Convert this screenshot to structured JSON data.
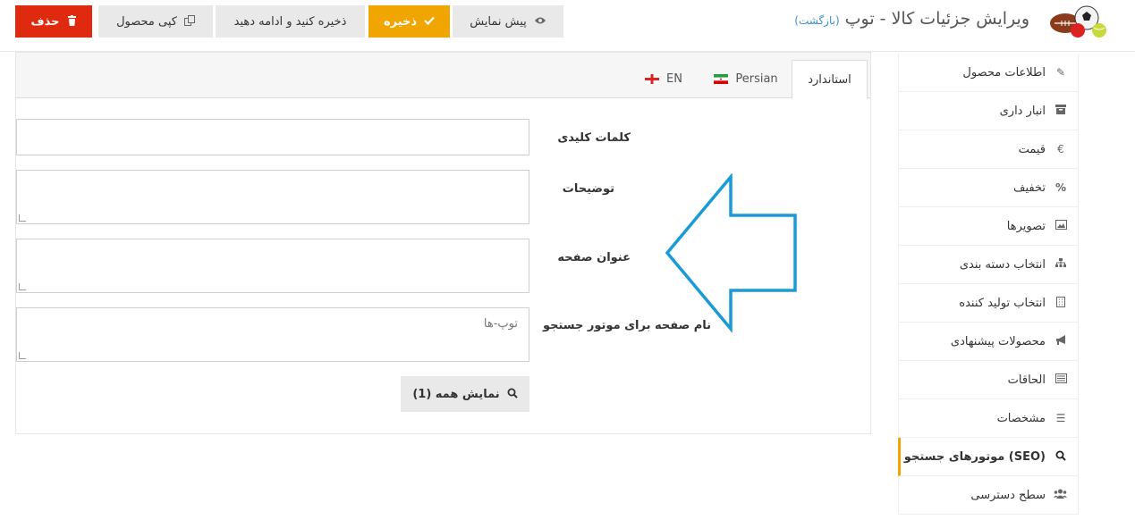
{
  "header": {
    "title": "ویرایش جزئیات کالا - توپ",
    "back_link": "(بازگشت)",
    "buttons": {
      "delete": "حذف",
      "copy": "کپی محصول",
      "save_continue": "ذخیره کنید و ادامه دهید",
      "save": "ذخیره",
      "preview": "پیش نمایش"
    }
  },
  "sidebar": {
    "items": [
      {
        "label": "اطلاعات محصول",
        "icon": "pencil-icon"
      },
      {
        "label": "انبار داری",
        "icon": "archive-icon"
      },
      {
        "label": "قیمت",
        "icon": "euro-icon"
      },
      {
        "label": "تخفیف",
        "icon": "percent-icon"
      },
      {
        "label": "تصویرها",
        "icon": "image-icon"
      },
      {
        "label": "انتخاب دسته بندی",
        "icon": "sitemap-icon"
      },
      {
        "label": "انتخاب تولید کننده",
        "icon": "building-icon"
      },
      {
        "label": "محصولات پیشنهادی",
        "icon": "bullhorn-icon"
      },
      {
        "label": "الحاقات",
        "icon": "list-alt-icon"
      },
      {
        "label": "مشخصات",
        "icon": "bars-icon"
      },
      {
        "label": "(SEO) موتورهای جستجو",
        "icon": "search-icon",
        "active": true
      },
      {
        "label": "سطح دسترسی",
        "icon": "users-icon"
      }
    ]
  },
  "tabs": [
    {
      "label": "استاندارد",
      "active": true
    },
    {
      "label": "Persian",
      "flag": "iran-flag"
    },
    {
      "label": "EN",
      "flag": "england-flag"
    }
  ],
  "form": {
    "keywords_label": "کلمات کلیدی",
    "keywords_value": "",
    "description_label": "توضیحات",
    "description_value": "",
    "page_title_label": "عنوان صفحه",
    "page_title_value": "",
    "seo_name_label": "نام صفحه برای موتور جستجو",
    "seo_name_value": "توپ-ها",
    "show_all_label": "نمایش همه (1)"
  },
  "colors": {
    "delete": "#e02a10",
    "save": "#f1a500",
    "arrow": "#1a9bd7",
    "link": "#3b8fc6"
  }
}
